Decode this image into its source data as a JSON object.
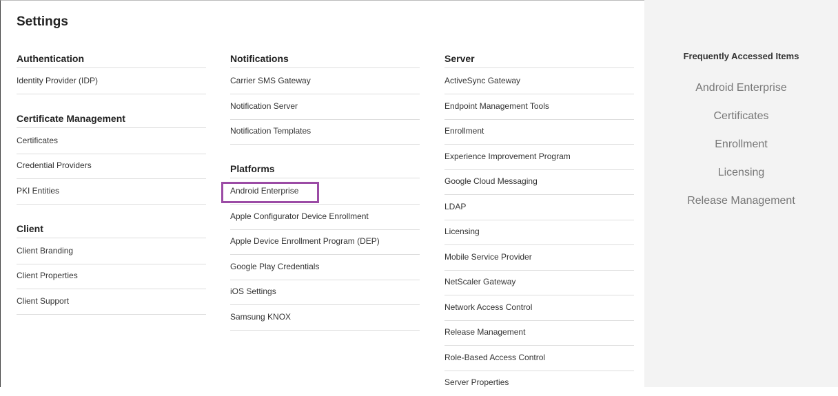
{
  "page": {
    "title": "Settings"
  },
  "columns": {
    "authentication": {
      "heading": "Authentication",
      "items": [
        "Identity Provider (IDP)"
      ]
    },
    "certificate_management": {
      "heading": "Certificate Management",
      "items": [
        "Certificates",
        "Credential Providers",
        "PKI Entities"
      ]
    },
    "client": {
      "heading": "Client",
      "items": [
        "Client Branding",
        "Client Properties",
        "Client Support"
      ]
    },
    "notifications": {
      "heading": "Notifications",
      "items": [
        "Carrier SMS Gateway",
        "Notification Server",
        "Notification Templates"
      ]
    },
    "platforms": {
      "heading": "Platforms",
      "items": [
        "Android Enterprise",
        "Apple Configurator Device Enrollment",
        "Apple Device Enrollment Program (DEP)",
        "Google Play Credentials",
        "iOS Settings",
        "Samsung KNOX"
      ]
    },
    "server": {
      "heading": "Server",
      "items": [
        "ActiveSync Gateway",
        "Endpoint Management Tools",
        "Enrollment",
        "Experience Improvement Program",
        "Google Cloud Messaging",
        "LDAP",
        "Licensing",
        "Mobile Service Provider",
        "NetScaler Gateway",
        "Network Access Control",
        "Release Management",
        "Role-Based Access Control",
        "Server Properties"
      ]
    }
  },
  "sidebar": {
    "title": "Frequently Accessed Items",
    "items": [
      "Android Enterprise",
      "Certificates",
      "Enrollment",
      "Licensing",
      "Release Management"
    ]
  },
  "highlight": {
    "item": "Android Enterprise",
    "color": "#9b4ba5"
  }
}
